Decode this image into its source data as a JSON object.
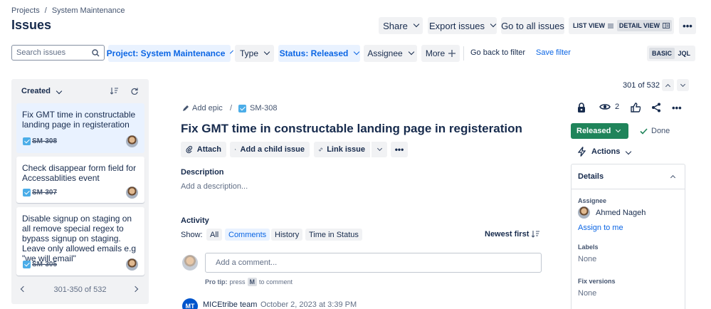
{
  "breadcrumb": {
    "projects": "Projects",
    "separator": "/",
    "project": "System Maintenance"
  },
  "page_title": "Issues",
  "header_actions": {
    "share": "Share",
    "export": "Export issues",
    "go_all": "Go to all issues",
    "list_view": "LIST VIEW",
    "detail_view": "DETAIL VIEW",
    "more": "•••"
  },
  "filters": {
    "search_placeholder": "Search issues",
    "project": "Project: System Maintenance",
    "type": "Type",
    "status": "Status: Released",
    "assignee": "Assignee",
    "more": "More",
    "go_back": "Go back to filter",
    "save": "Save filter",
    "basic": "BASIC",
    "jql": "JQL"
  },
  "list": {
    "sort_label": "Created",
    "cards": [
      {
        "title": "Fix GMT time in constructable landing page in registeration",
        "key": "SM-308"
      },
      {
        "title": "Check disappear form field for Accessablities event",
        "key": "SM-307"
      },
      {
        "title": "Disable signup on staging on all remove special regex to bypass signup on staging. Leave only allowed emails e.g \"we will email\"",
        "key": "SM-305"
      }
    ],
    "pagination": "301-350 of 532"
  },
  "issue": {
    "counter": "301 of 532",
    "add_epic": "Add epic",
    "sep": "/",
    "key": "SM-308",
    "watchers": "2",
    "title": "Fix GMT time in constructable landing page in registeration",
    "attach": "Attach",
    "add_child": "Add a child issue",
    "link_issue": "Link issue",
    "more": "•••",
    "description_label": "Description",
    "description_placeholder": "Add a description...",
    "status_button": "Released",
    "done": "Done",
    "actions": "Actions"
  },
  "activity": {
    "heading": "Activity",
    "show": "Show:",
    "tabs": [
      "All",
      "Comments",
      "History",
      "Time in Status"
    ],
    "sort": "Newest first",
    "comment_placeholder": "Add a comment...",
    "protip_prefix": "Pro tip:",
    "protip_press": "press",
    "protip_key": "M",
    "protip_suffix": "to comment",
    "entry_initials": "MT",
    "entry_author": "MICEtribe team",
    "entry_date": "October 2, 2023 at 3:39 PM"
  },
  "details": {
    "heading": "Details",
    "assignee_label": "Assignee",
    "assignee_name": "Ahmed Nageh",
    "assign_me": "Assign to me",
    "labels_label": "Labels",
    "labels_value": "None",
    "fix_label": "Fix versions",
    "fix_value": "None"
  },
  "colors": {
    "accent": "#0c66e4",
    "released_green": "#1f845a",
    "selected_bg": "#e9f2ff",
    "panel_bg": "#f1f2f4"
  },
  "icons": [
    "search-icon",
    "plus-icon",
    "sort-icon",
    "refresh-icon",
    "checkbox-icon",
    "pencil-icon",
    "paperclip-icon",
    "link-icon",
    "lock-icon",
    "eye-icon",
    "thumbs-up-icon",
    "share-icon",
    "lightning-icon",
    "check-icon"
  ]
}
